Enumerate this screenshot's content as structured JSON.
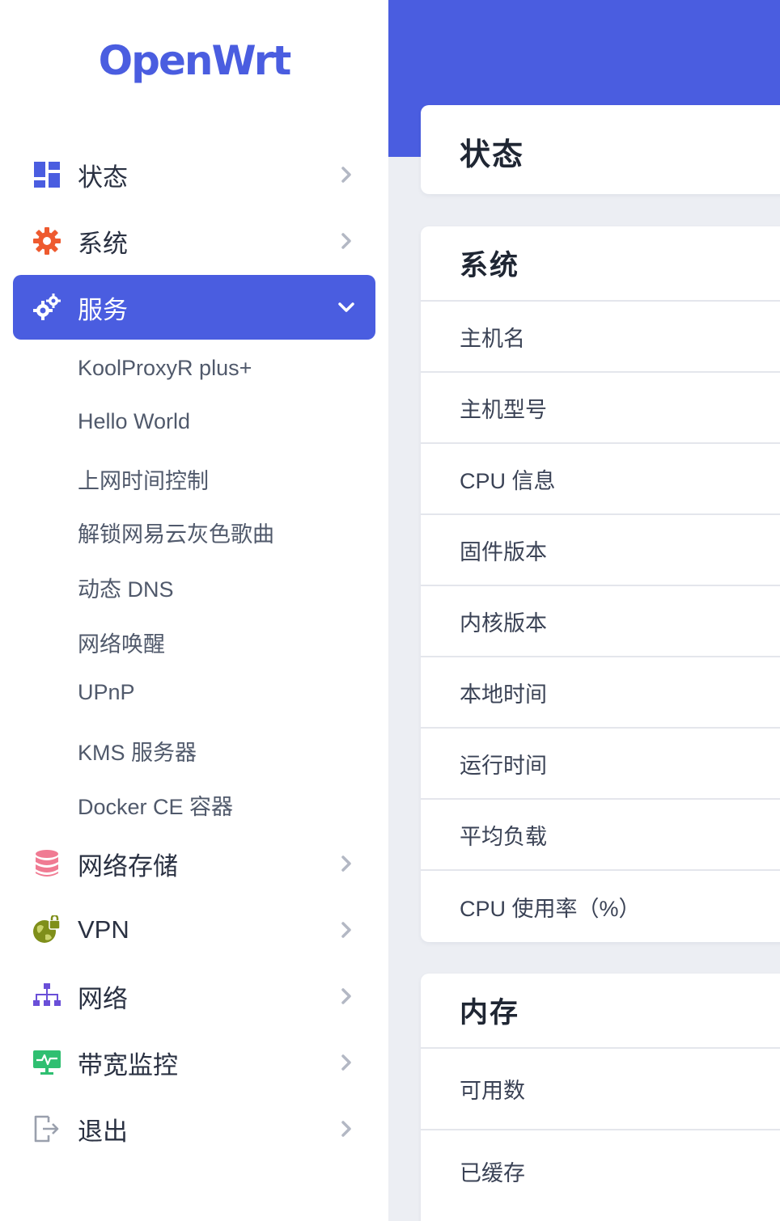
{
  "brand": {
    "logo_text": "OpenWrt",
    "accent": "#4a5de0"
  },
  "sidebar": {
    "items": [
      {
        "label": "状态",
        "icon": "dashboard-icon",
        "expanded": false
      },
      {
        "label": "系统",
        "icon": "gear-icon",
        "expanded": false
      },
      {
        "label": "服务",
        "icon": "gears-icon",
        "expanded": true,
        "active": true
      },
      {
        "label": "网络存储",
        "icon": "database-icon",
        "expanded": false
      },
      {
        "label": "VPN",
        "icon": "globe-lock-icon",
        "expanded": false
      },
      {
        "label": "网络",
        "icon": "sitemap-icon",
        "expanded": false
      },
      {
        "label": "带宽监控",
        "icon": "monitor-pulse-icon",
        "expanded": false
      },
      {
        "label": "退出",
        "icon": "logout-icon",
        "expanded": false
      }
    ],
    "services_submenu": [
      "KoolProxyR plus+",
      "Hello World",
      "上网时间控制",
      "解锁网易云灰色歌曲",
      "动态 DNS",
      "网络唤醒",
      "UPnP",
      "KMS 服务器",
      "Docker CE 容器"
    ]
  },
  "main": {
    "page_title": "状态",
    "system_card": {
      "title": "系统",
      "rows": [
        "主机名",
        "主机型号",
        "CPU 信息",
        "固件版本",
        "内核版本",
        "本地时间",
        "运行时间",
        "平均负载",
        "CPU 使用率（%）"
      ]
    },
    "memory_card": {
      "title": "内存",
      "rows": [
        "可用数",
        "已缓存"
      ]
    }
  }
}
